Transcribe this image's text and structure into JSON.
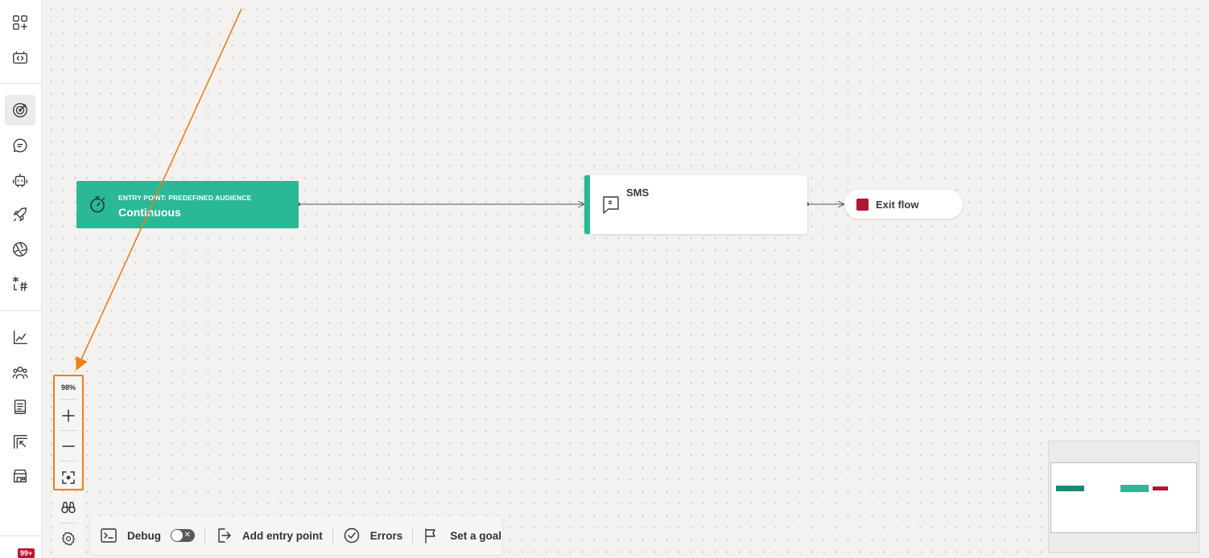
{
  "rail": {
    "items_top": [
      "apps-add-icon",
      "code-box-icon"
    ],
    "items_mid": [
      "target-icon",
      "chat-icon",
      "bot-icon",
      "rocket-icon",
      "aperture-icon",
      "hashtag-icon"
    ],
    "items_bottom": [
      "chart-icon",
      "people-icon",
      "book-icon",
      "cursor-box-icon",
      "store-icon"
    ],
    "notification_badge": "99+"
  },
  "flow": {
    "entry": {
      "label": "ENTRY POINT: PREDEFINED AUDIENCE",
      "title": "Continuous",
      "color": "#2ab897"
    },
    "sms": {
      "title": "SMS",
      "accent": "#2ab897"
    },
    "exit": {
      "label": "Exit flow",
      "color": "#b3142f"
    }
  },
  "zoom": {
    "level": "98%"
  },
  "toolbar": {
    "debug_label": "Debug",
    "debug_enabled": false,
    "add_entry_label": "Add entry point",
    "errors_label": "Errors",
    "goal_label": "Set a goal"
  },
  "colors": {
    "annotation_arrow": "#ef7f1a",
    "minimap_entry": "#178a70",
    "minimap_sms": "#2ab897",
    "minimap_exit": "#b3142f"
  }
}
